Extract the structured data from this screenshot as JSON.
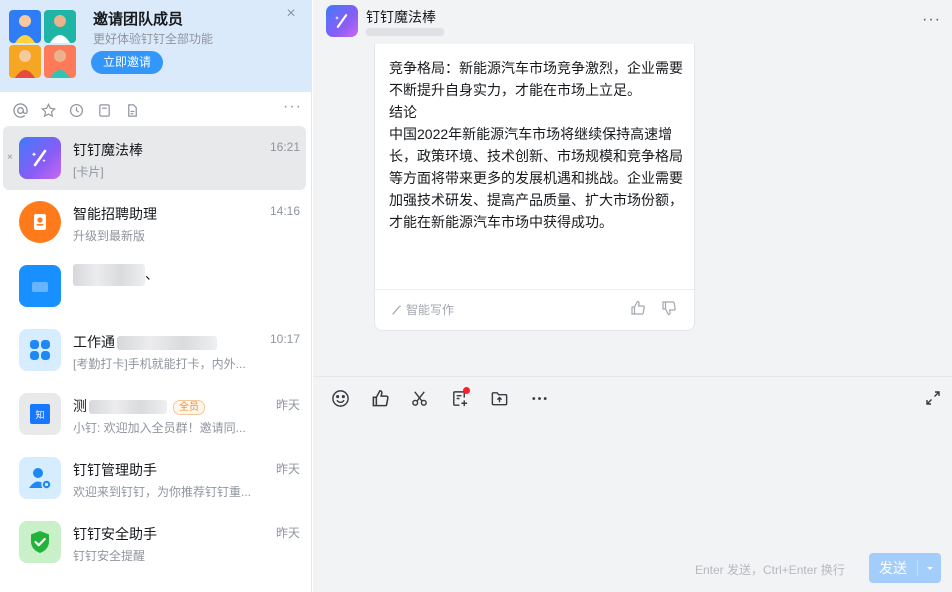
{
  "invite": {
    "title": "邀请团队成员",
    "subtitle": "更好体验钉钉全部功能",
    "button": "立即邀请"
  },
  "filters": {
    "icons": [
      "at-icon",
      "star-icon",
      "clock-icon",
      "note-icon",
      "doc-icon"
    ],
    "more": "···"
  },
  "chats": [
    {
      "name": "钉钉魔法棒",
      "preview": "[卡片]",
      "time": "16:21",
      "active": true
    },
    {
      "name": "智能招聘助理",
      "preview": "升级到最新版",
      "time": "14:16"
    },
    {
      "name": "",
      "preview": "",
      "time": "",
      "name_suffix": "、"
    },
    {
      "name": "工作通",
      "preview": "[考勤打卡]手机就能打卡，内外...",
      "time": "10:17"
    },
    {
      "name": "测",
      "badge": "全员",
      "preview": "小钉: 欢迎加入全员群！邀请同...",
      "time": "昨天"
    },
    {
      "name": "钉钉管理助手",
      "preview": "欢迎来到钉钉，为你推荐钉钉重...",
      "time": "昨天"
    },
    {
      "name": "钉钉安全助手",
      "preview": "钉钉安全提醒",
      "time": "昨天"
    }
  ],
  "header": {
    "title": "钉钉魔法棒",
    "more": "···"
  },
  "card": {
    "lines": [
      "竞争格局：新能源汽车市场竞争激烈，企业需要不断提升自身实力，才能在市场上立足。",
      "结论",
      "中国2022年新能源汽车市场将继续保持高速增长，政策环境、技术创新、市场规模和竞争格局等方面将带来更多的发展机遇和挑战。企业需要加强技术研发、提高产品质量、扩大市场份额，才能在新能源汽车市场中获得成功。"
    ],
    "footer_label": "智能写作"
  },
  "composer": {
    "hint": "Enter 发送，Ctrl+Enter 换行",
    "send": "发送"
  },
  "colors": {
    "accent": "#3296fa",
    "send_disabled": "#a3cdfb",
    "panel_bg": "#f2f3f5",
    "invite_bg": "#dbeafb"
  }
}
